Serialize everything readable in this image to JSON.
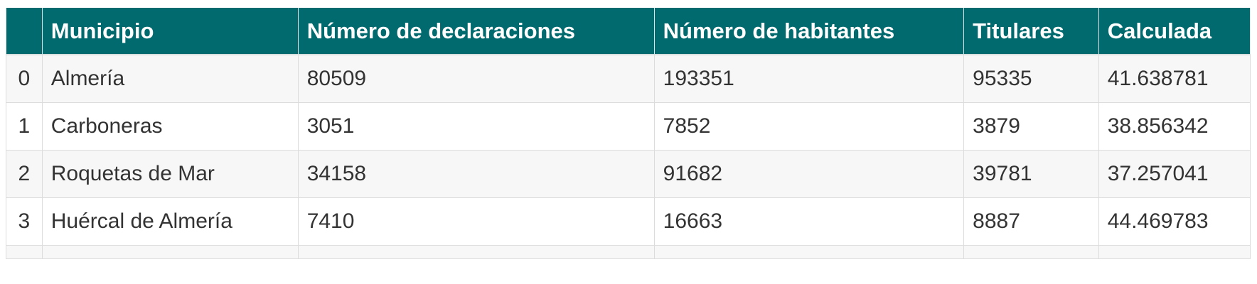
{
  "table": {
    "headers": [
      "",
      "Municipio",
      "Número de declaraciones",
      "Número de habitantes",
      "Titulares",
      "Calculada"
    ],
    "rows": [
      [
        "0",
        "Almería",
        "80509",
        "193351",
        "95335",
        "41.638781"
      ],
      [
        "1",
        "Carboneras",
        "3051",
        "7852",
        "3879",
        "38.856342"
      ],
      [
        "2",
        "Roquetas de Mar",
        "34158",
        "91682",
        "39781",
        "37.257041"
      ],
      [
        "3",
        "Huércal de Almería",
        "7410",
        "16663",
        "8887",
        "44.469783"
      ]
    ]
  },
  "colors": {
    "header_bg": "#006a6f",
    "header_text": "#ffffff",
    "row_alt_bg": "#f7f7f7",
    "border": "#dcdcdc"
  }
}
